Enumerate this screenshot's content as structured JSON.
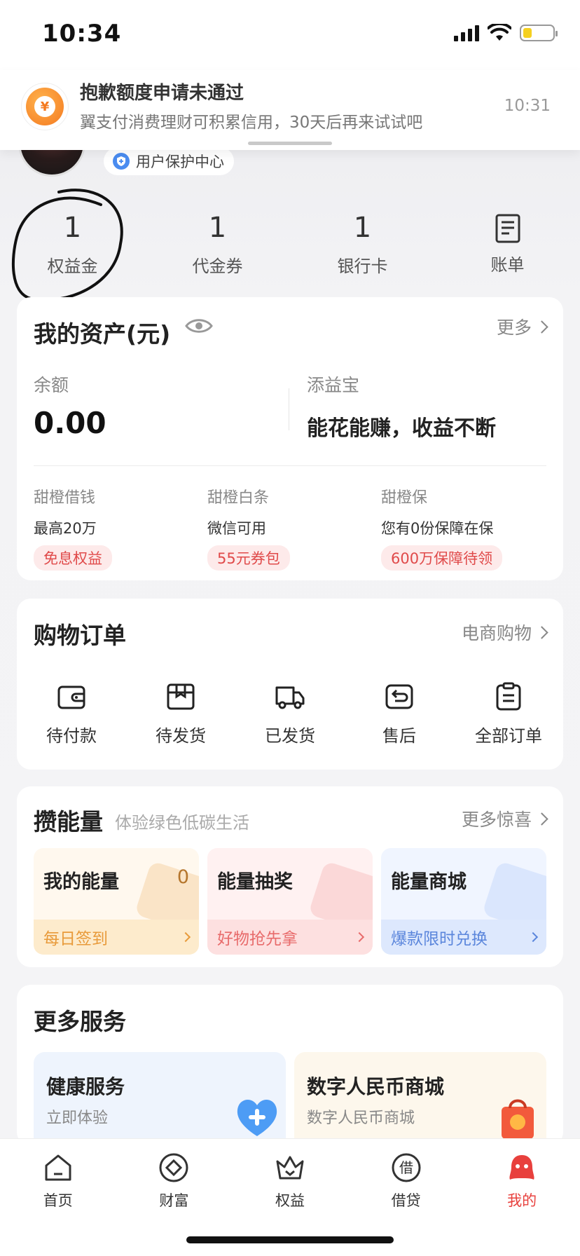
{
  "status": {
    "time": "10:34"
  },
  "notification": {
    "title": "抱歉额度申请未通过",
    "subtitle": "翼支付消费理财可积累信用，30天后再来试试吧",
    "time": "10:31"
  },
  "profile": {
    "protection_label": "用户保护中心"
  },
  "stats": [
    {
      "value": "1",
      "label": "权益金"
    },
    {
      "value": "1",
      "label": "代金券"
    },
    {
      "value": "1",
      "label": "银行卡"
    },
    {
      "label": "账单",
      "icon": "bill-icon"
    }
  ],
  "assets": {
    "title": "我的资产(元)",
    "more": "更多",
    "balance_label": "余额",
    "balance_value": "0.00",
    "tianyibao_label": "添益宝",
    "tianyibao_value": "能花能赚，收益不断",
    "products": [
      {
        "name": "甜橙借钱",
        "desc": "最高20万",
        "tag": "免息权益"
      },
      {
        "name": "甜橙白条",
        "desc": "微信可用",
        "tag": "55元券包"
      },
      {
        "name": "甜橙保",
        "desc": "您有0份保障在保",
        "tag": "600万保障待领"
      }
    ]
  },
  "orders": {
    "title": "购物订单",
    "more": "电商购物",
    "items": [
      {
        "label": "待付款",
        "icon": "wallet-icon"
      },
      {
        "label": "待发货",
        "icon": "package-icon"
      },
      {
        "label": "已发货",
        "icon": "truck-icon"
      },
      {
        "label": "售后",
        "icon": "return-icon"
      },
      {
        "label": "全部订单",
        "icon": "clipboard-icon"
      }
    ]
  },
  "energy": {
    "title": "攒能量",
    "subtitle": "体验绿色低碳生活",
    "more": "更多惊喜",
    "tiles": [
      {
        "title": "我的能量",
        "value": "0",
        "action": "每日签到"
      },
      {
        "title": "能量抽奖",
        "action": "好物抢先拿"
      },
      {
        "title": "能量商城",
        "action": "爆款限时兑换"
      }
    ]
  },
  "services": {
    "title": "更多服务",
    "tiles": [
      {
        "title": "健康服务",
        "subtitle": "立即体验"
      },
      {
        "title": "数字人民币商城",
        "subtitle": "数字人民币商城"
      }
    ]
  },
  "tabbar": {
    "items": [
      {
        "label": "首页",
        "icon": "home-icon"
      },
      {
        "label": "财富",
        "icon": "wealth-icon"
      },
      {
        "label": "权益",
        "icon": "crown-icon"
      },
      {
        "label": "借贷",
        "icon": "loan-icon",
        "glyph": "借"
      },
      {
        "label": "我的",
        "icon": "profile-icon",
        "active": true
      }
    ]
  },
  "colors": {
    "accent": "#e8403d",
    "tag_bg": "#fdeaea",
    "tag_text": "#e04a4a"
  }
}
